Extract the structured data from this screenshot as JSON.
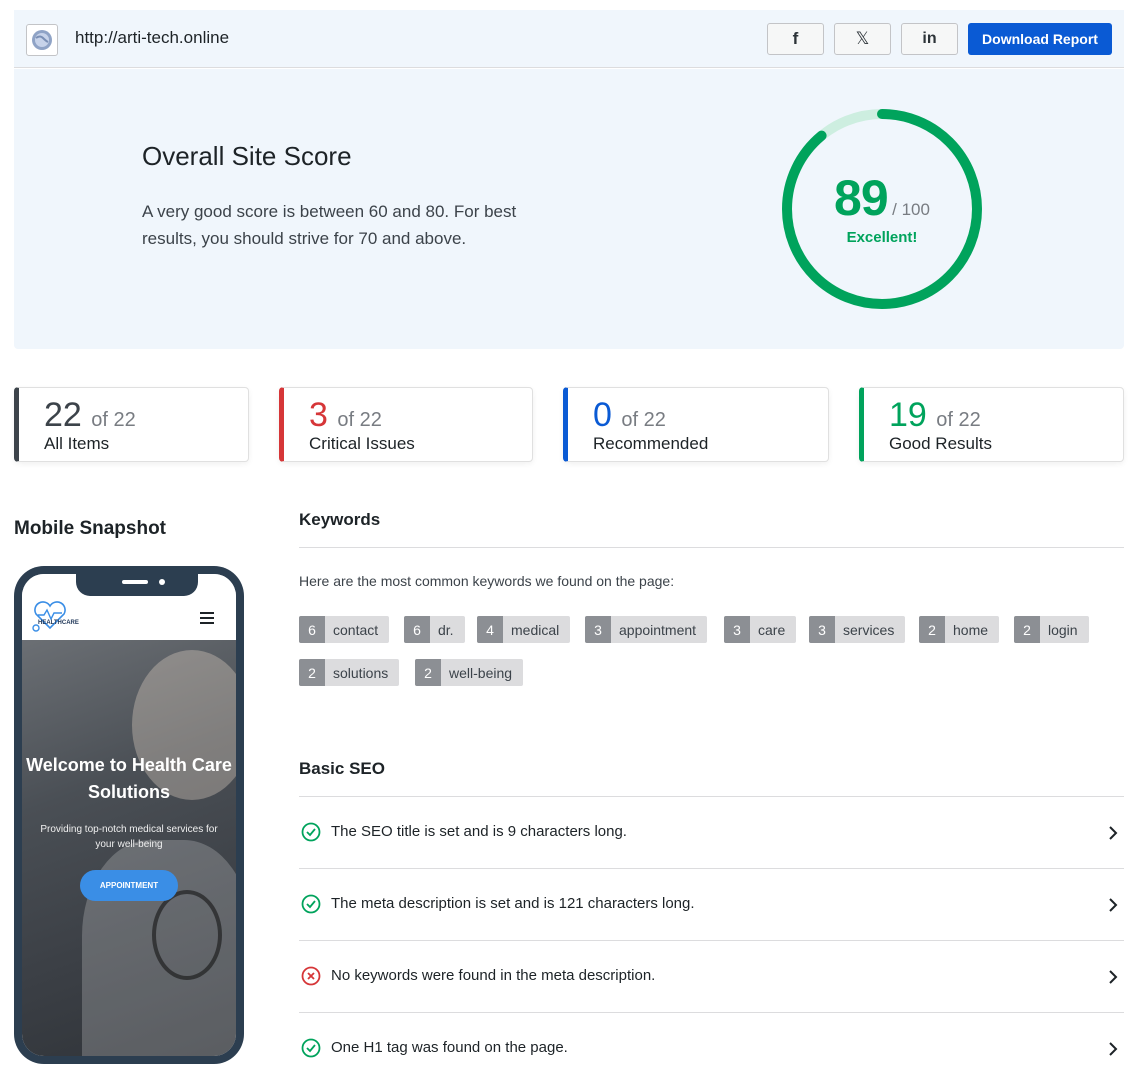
{
  "topbar": {
    "url": "http://arti-tech.online",
    "share": [
      {
        "name": "facebook",
        "label": "f"
      },
      {
        "name": "x",
        "label": "𝕏"
      },
      {
        "name": "linkedin",
        "label": "in"
      }
    ],
    "download_label": "Download Report"
  },
  "score": {
    "title": "Overall Site Score",
    "description": "A very good score is between 60 and 80. For best results, you should strive for 70 and above.",
    "value": "89",
    "max": "/ 100",
    "verdict": "Excellent!",
    "fraction": 0.89,
    "color": "#00a35c",
    "track_color": "#cdeee0"
  },
  "stats": [
    {
      "count": "22",
      "of": "of 22",
      "label": "All Items",
      "color": "#3c434a"
    },
    {
      "count": "3",
      "of": "of 22",
      "label": "Critical Issues",
      "color": "#d63638"
    },
    {
      "count": "0",
      "of": "of 22",
      "label": "Recommended",
      "color": "#0a5ad4"
    },
    {
      "count": "19",
      "of": "of 22",
      "label": "Good Results",
      "color": "#00a35c"
    }
  ],
  "mobile": {
    "heading": "Mobile Snapshot",
    "logo_text": "HEALTHCARE",
    "hero_title": "Welcome to Health Care Solutions",
    "hero_sub": "Providing top-notch medical services for your well-being",
    "hero_button": "APPOINTMENT"
  },
  "keywords": {
    "heading": "Keywords",
    "intro": "Here are the most common keywords we found on the page:",
    "items": [
      {
        "count": "6",
        "word": "contact"
      },
      {
        "count": "6",
        "word": "dr."
      },
      {
        "count": "4",
        "word": "medical"
      },
      {
        "count": "3",
        "word": "appointment"
      },
      {
        "count": "3",
        "word": "care"
      },
      {
        "count": "3",
        "word": "services"
      },
      {
        "count": "2",
        "word": "home"
      },
      {
        "count": "2",
        "word": "login"
      },
      {
        "count": "2",
        "word": "solutions"
      },
      {
        "count": "2",
        "word": "well-being"
      }
    ]
  },
  "basic_seo": {
    "heading": "Basic SEO",
    "items": [
      {
        "status": "pass",
        "text": "The SEO title is set and is 9 characters long."
      },
      {
        "status": "pass",
        "text": "The meta description is set and is 121 characters long."
      },
      {
        "status": "fail",
        "text": "No keywords were found in the meta description."
      },
      {
        "status": "pass",
        "text": "One H1 tag was found on the page."
      }
    ]
  },
  "colors": {
    "accent": "#0a5ad4",
    "pass": "#00a35c",
    "fail": "#d63638"
  }
}
